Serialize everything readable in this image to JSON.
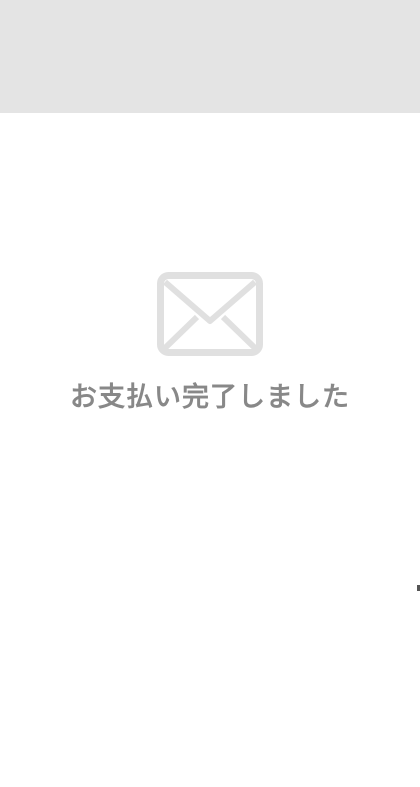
{
  "header": {
    "background": "#e4e4e4"
  },
  "main": {
    "icon": "envelope-icon",
    "message": "お支払い完了しました",
    "message_color": "#888888",
    "icon_color": "#e0e0e0"
  }
}
